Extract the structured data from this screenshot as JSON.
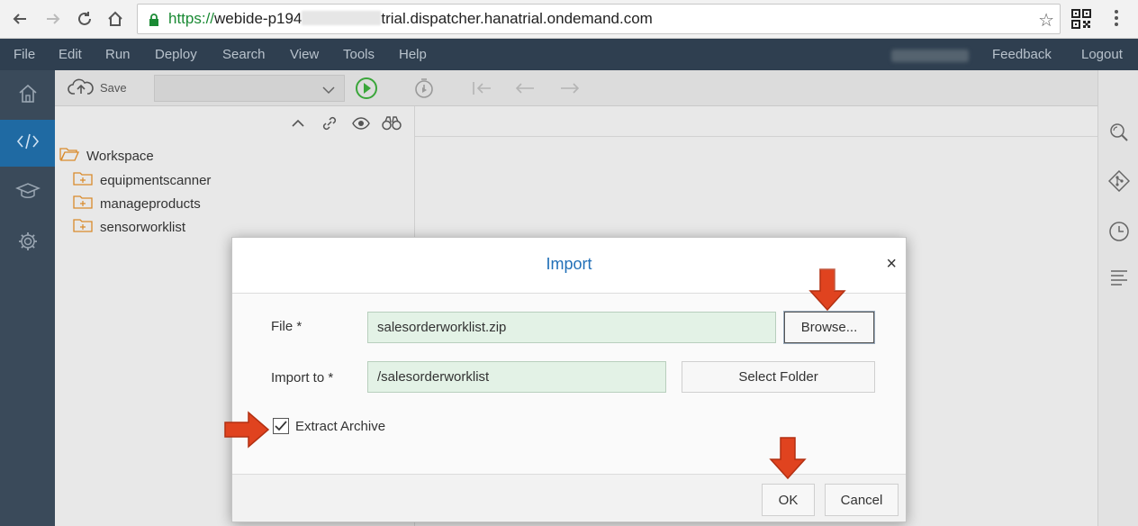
{
  "browser": {
    "url_scheme": "https://",
    "url_host_start": "webide-p194",
    "url_host_end": "trial.dispatcher.hanatrial.ondemand.com",
    "icons": [
      "back-icon",
      "forward-icon",
      "reload-icon",
      "home-icon",
      "lock-icon",
      "star-icon",
      "qr-icon",
      "kebab-icon"
    ]
  },
  "menu": {
    "items": [
      "File",
      "Edit",
      "Run",
      "Deploy",
      "Search",
      "View",
      "Tools",
      "Help"
    ],
    "feedback": "Feedback",
    "logout": "Logout"
  },
  "toolbar": {
    "save_label": "Save"
  },
  "workspace": {
    "root": "Workspace",
    "folders": [
      "equipmentscanner",
      "manageproducts",
      "sensorworklist"
    ]
  },
  "dialog": {
    "title": "Import",
    "close": "×",
    "file_label": "File  *",
    "file_value": "salesorderworklist.zip",
    "browse_label": "Browse...",
    "import_to_label": "Import to  *",
    "import_to_value": "/salesorderworklist",
    "select_folder_label": "Select Folder",
    "extract_label": "Extract Archive",
    "extract_checked": true,
    "ok_label": "OK",
    "cancel_label": "Cancel"
  },
  "colors": {
    "menubar_bg": "#2f3f50",
    "leftnav_bg": "#3a4a5a",
    "active_nav": "#1f6aa3",
    "dialog_title": "#2270b8",
    "input_bg": "#e3f2e6",
    "arrow_red": "#e0431f",
    "folder_orange": "#d98a2b"
  }
}
